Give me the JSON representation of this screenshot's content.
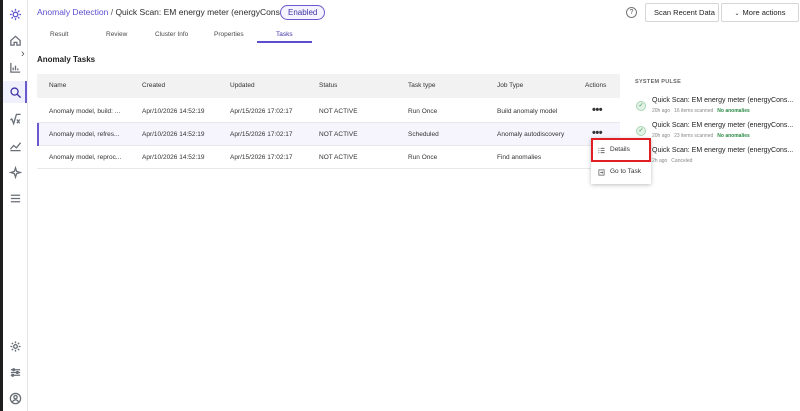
{
  "header": {
    "breadcrumb_link": "Anomaly Detection",
    "breadcrumb_sep": " / ",
    "breadcrumb_current": "Quick Scan: EM energy meter (energyConsumption)",
    "status_badge": "Enabled",
    "help_icon_glyph": "?",
    "scan_button": "Scan Recent Data",
    "more_actions_button": "More actions",
    "more_actions_icon": "chevron-down-icon"
  },
  "tabs": [
    "Result",
    "Review",
    "Cluster Info",
    "Properties",
    "Tasks"
  ],
  "active_tab": "Tasks",
  "section_title": "Anomaly Tasks",
  "table": {
    "columns": [
      "Name",
      "Created",
      "Updated",
      "Status",
      "Task type",
      "Job Type",
      "Actions"
    ],
    "rows": [
      {
        "name": "Anomaly model, build: ...",
        "created": "Apr/10/2026 14:52:19",
        "updated": "Apr/15/2026 17:02:17",
        "status": "NOT ACTIVE",
        "task_type": "Run Once",
        "job_type": "Build anomaly model",
        "actions": "•••"
      },
      {
        "name": "Anomaly model, refres...",
        "created": "Apr/10/2026 14:52:19",
        "updated": "Apr/15/2026 17:02:17",
        "status": "NOT ACTIVE",
        "task_type": "Scheduled",
        "job_type": "Anomaly autodiscovery",
        "actions": "•••"
      },
      {
        "name": "Anomaly model, reproc...",
        "created": "Apr/10/2026 14:52:19",
        "updated": "Apr/15/2026 17:02:17",
        "status": "NOT ACTIVE",
        "task_type": "Run Once",
        "job_type": "Find anomalies",
        "actions": "•••"
      }
    ]
  },
  "actions_menu": {
    "items": [
      {
        "label": "Details",
        "icon": "list-icon"
      },
      {
        "label": "Go to Task",
        "icon": "external-link-icon"
      }
    ]
  },
  "system_pulse": {
    "title": "SYSTEM PULSE",
    "items": [
      {
        "name": "Quick Scan: EM energy meter (energyCons...",
        "age": "20h ago",
        "scanned": "16 items scanned",
        "result": "No anomalies",
        "icon": "check-circle-icon"
      },
      {
        "name": "Quick Scan: EM energy meter (energyCons...",
        "age": "20h ago",
        "scanned": "23 items scanned",
        "result": "No anomalies",
        "icon": "check-circle-icon"
      },
      {
        "name": "Quick Scan: EM energy meter (energyCons...",
        "age": "2h ago",
        "scanned": "Canceled",
        "result": "",
        "icon": ""
      }
    ]
  },
  "colors": {
    "accent": "#5b4fcf",
    "highlight_box": "#e01e24",
    "success": "#2d8a46"
  },
  "nav_icons": [
    "app-logo-icon",
    "home-icon",
    "chevron-right-icon",
    "bar-chart-icon",
    "search-icon",
    "formula-icon",
    "trend-icon",
    "sparkle-icon",
    "menu-icon",
    "settings-icon",
    "sliders-icon",
    "user-icon"
  ]
}
